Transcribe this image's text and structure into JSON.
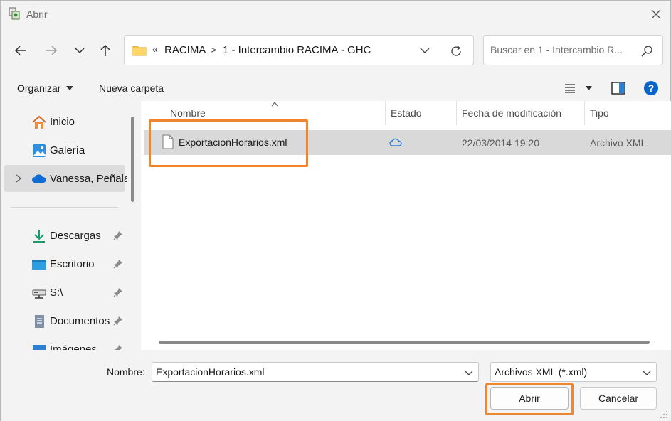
{
  "window": {
    "title": "Abrir",
    "close_icon": "close-icon"
  },
  "nav": {
    "back_icon": "arrow-left-icon",
    "forward_icon": "arrow-right-icon",
    "recent_icon": "chevron-down-icon",
    "up_icon": "arrow-up-icon"
  },
  "address": {
    "lead": "«",
    "crumbs": [
      "RACIMA",
      "1 - Intercambio RACIMA - GHC"
    ],
    "separator": ">"
  },
  "search": {
    "placeholder": "Buscar en 1 - Intercambio R..."
  },
  "toolbar": {
    "organize_label": "Organizar",
    "new_folder_label": "Nueva carpeta"
  },
  "sidebar": {
    "items": [
      {
        "label": "Inicio",
        "icon": "home-icon"
      },
      {
        "label": "Galería",
        "icon": "gallery-icon"
      },
      {
        "label": "Vanessa, Peñalar",
        "icon": "onedrive-cloud-icon"
      },
      {
        "label": "Descargas",
        "icon": "download-icon"
      },
      {
        "label": "Escritorio",
        "icon": "desktop-icon"
      },
      {
        "label": "S:\\",
        "icon": "network-drive-icon"
      },
      {
        "label": "Documentos",
        "icon": "documents-icon"
      },
      {
        "label": "Imágenes",
        "icon": "pictures-icon"
      }
    ]
  },
  "table": {
    "columns": [
      "Nombre",
      "Estado",
      "Fecha de modificación",
      "Tipo"
    ],
    "rows": [
      {
        "name": "ExportacionHorarios.xml",
        "status_icon": "cloud-icon",
        "modified": "22/03/2014 19:20",
        "type": "Archivo XML"
      }
    ]
  },
  "footer": {
    "name_label": "Nombre:",
    "name_value": "ExportacionHorarios.xml",
    "filter_value": "Archivos XML (*.xml)",
    "open_label": "Abrir",
    "cancel_label": "Cancelar"
  },
  "colors": {
    "highlight": "#f0852d",
    "accent": "#0a64c8",
    "selection": "#d9d9d9"
  }
}
